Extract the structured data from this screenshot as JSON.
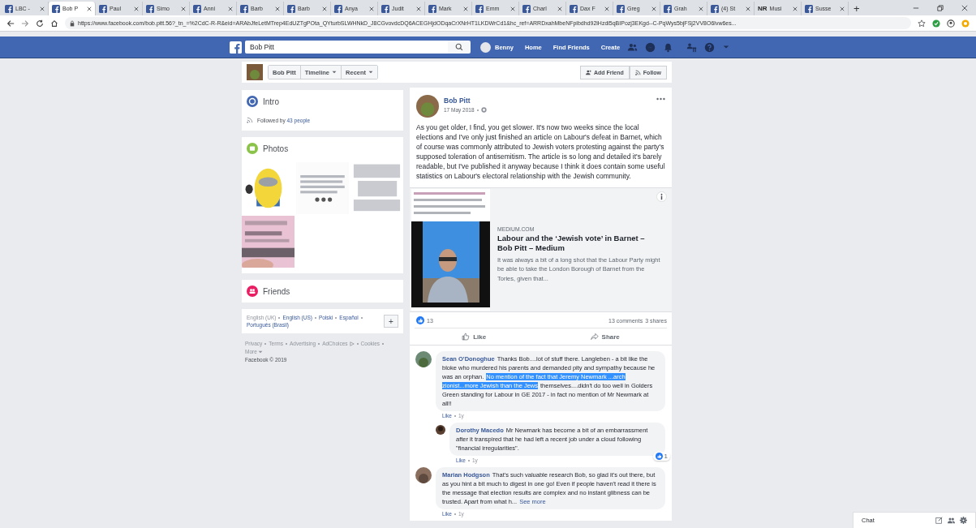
{
  "browser": {
    "tabs": [
      {
        "label": "LBC -",
        "kind": "facebook",
        "selected": false
      },
      {
        "label": "Bob P",
        "kind": "facebook",
        "selected": true
      },
      {
        "label": "Paul",
        "kind": "facebook",
        "selected": false
      },
      {
        "label": "Simo",
        "kind": "facebook",
        "selected": false
      },
      {
        "label": "Anni",
        "kind": "facebook",
        "selected": false
      },
      {
        "label": "Barb",
        "kind": "facebook",
        "selected": false
      },
      {
        "label": "Barb",
        "kind": "facebook",
        "selected": false
      },
      {
        "label": "Anya",
        "kind": "facebook",
        "selected": false
      },
      {
        "label": "Judit",
        "kind": "facebook",
        "selected": false
      },
      {
        "label": "Mark",
        "kind": "facebook",
        "selected": false
      },
      {
        "label": "Emm",
        "kind": "facebook",
        "selected": false
      },
      {
        "label": "Charl",
        "kind": "facebook",
        "selected": false
      },
      {
        "label": "Dax F",
        "kind": "facebook",
        "selected": false
      },
      {
        "label": "Greg",
        "kind": "facebook",
        "selected": false
      },
      {
        "label": "Grah",
        "kind": "facebook",
        "selected": false
      },
      {
        "label": "(4) St",
        "kind": "facebook",
        "selected": false
      },
      {
        "label": "Musi",
        "kind": "text",
        "icon_text": "NR",
        "selected": false
      },
      {
        "label": "Susse",
        "kind": "facebook",
        "selected": false
      }
    ],
    "new_tab": "+",
    "url": "https://www.facebook.com/bob.pitt.56?_tn_=%2CdC-R-R&eid=ARAbJfeLetMTrep4EdUZTgPOta_QYturbSLWHNkD_J8CGvovdcDQ6ACEGHjdODqaCrXNrHT1LKDWrCd1&hc_ref=ARRDxahMbeNFpibdhd92iHzdi5qBIPozj3EKgd--C-PqWys5bjFSj2VV8O6lvw6es..."
  },
  "header": {
    "search": {
      "value": "Bob Pitt"
    },
    "user": "Benny",
    "nav": [
      "Home",
      "Find Friends",
      "Create"
    ]
  },
  "profile_bar": {
    "name": "Bob Pitt",
    "menus": [
      "Timeline",
      "Recent"
    ],
    "buttons": [
      "Add Friend",
      "Follow"
    ]
  },
  "intro": {
    "title": "Intro",
    "followed_prefix": "Followed by",
    "followed_link": "43 people"
  },
  "photos": {
    "title": "Photos"
  },
  "friends": {
    "title": "Friends"
  },
  "languages": {
    "items": [
      {
        "label": "English (UK)",
        "selected": true
      },
      {
        "label": "English (US)",
        "selected": false
      },
      {
        "label": "Polski",
        "selected": false
      },
      {
        "label": "Español",
        "selected": false
      },
      {
        "label": "Português (Brasil)",
        "selected": false
      }
    ],
    "add": "+"
  },
  "footer": {
    "links": [
      "Privacy",
      "Terms",
      "Advertising",
      "AdChoices",
      "Cookies"
    ],
    "more": "More",
    "copyright": "Facebook © 2019"
  },
  "post": {
    "author": "Bob Pitt",
    "date": "17 May 2018",
    "text": "As you get older, I find, you get slower. It's now two weeks since the local elections and I've only just finished an article on Labour's defeat in Barnet, which of course was commonly attributed to Jewish voters protesting against the party's supposed toleration of antisemitism. The article is so long and detailed it's barely readable, but I've published it anyway because I think it does contain some useful statistics on Labour's electoral relationship with the Jewish community.",
    "link": {
      "domain": "MEDIUM.COM",
      "title": "Labour and the ‘Jewish vote’ in Barnet – Bob Pitt – Medium",
      "description": "It was always a bit of a long shot that the Labour Party might be able to take the London Borough of Barnet from the Tories, given that..."
    },
    "reactions": "13",
    "comments_count": "13 comments",
    "shares": "3 shares",
    "actions": [
      "Like",
      "Share"
    ],
    "comments": [
      {
        "author": "Sean O'Donoghue",
        "parts": [
          {
            "text": "Thanks Bob....lot of stuff there. Langleben - a bit like the bloke who murdered his parents and demanded pity and sympathy because he was an orphan.",
            "highlighted": false
          },
          {
            "text": "No mention of the fact that Jeremy Newmark ...arch zionist...more Jewish than the Jews",
            "highlighted": true
          },
          {
            "text": "themselves....didn't do too well in Golders Green standing for Labour in GE 2017 - in fact no mention of Mr Newmark at all!!",
            "highlighted": false
          }
        ],
        "like": "Like",
        "time": "1y",
        "replies": [
          {
            "author": "Dorothy Macedo",
            "parts": [
              {
                "text": "Mr Newmark has become a bit of an embarrassment after it transpired that he had left a recent job under a cloud following \"financial irregularities\".",
                "highlighted": false
              }
            ],
            "reaction_count": "1",
            "like": "Like",
            "time": "1y"
          }
        ]
      },
      {
        "author": "Marian Hodgson",
        "parts": [
          {
            "text": "That's such valuable research Bob, so glad it's out there, but as you hint a bit much to digest in one go! Even if people haven't read it there is the message that election results are complex and no instant glibness can be trusted. Apart from what h...",
            "highlighted": false
          }
        ],
        "see_more": "See more",
        "like": "Like",
        "time": "1y"
      }
    ]
  },
  "chat": {
    "label": "Chat"
  }
}
